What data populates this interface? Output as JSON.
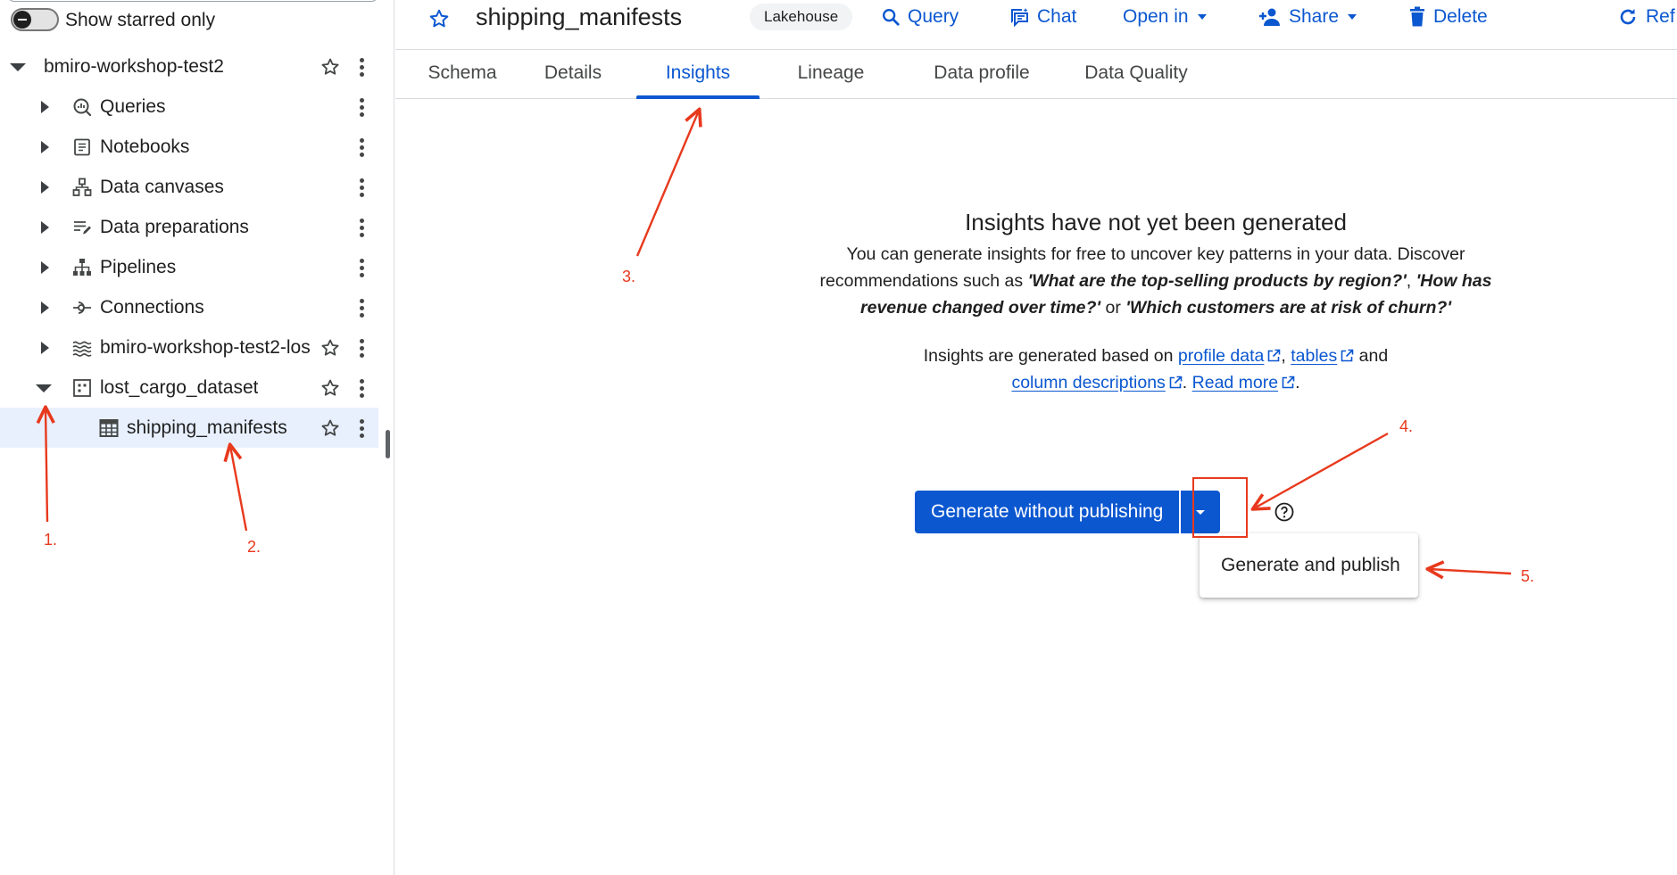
{
  "explorer": {
    "starred_toggle_label": "Show starred only",
    "project": {
      "label": "bmiro-workshop-test2"
    },
    "items": [
      {
        "label": "Queries",
        "icon": "queries-icon"
      },
      {
        "label": "Notebooks",
        "icon": "notebook-icon"
      },
      {
        "label": "Data canvases",
        "icon": "data-canvas-icon"
      },
      {
        "label": "Data preparations",
        "icon": "data-preparation-icon"
      },
      {
        "label": "Pipelines",
        "icon": "pipeline-icon"
      },
      {
        "label": "Connections",
        "icon": "connection-icon"
      },
      {
        "label": "bmiro-workshop-test2-los",
        "icon": "lake-icon"
      },
      {
        "label": "lost_cargo_dataset",
        "icon": "dataset-icon"
      },
      {
        "label": "shipping_manifests",
        "icon": "table-icon",
        "selected": true
      }
    ]
  },
  "header": {
    "title": "shipping_manifests",
    "chip": "Lakehouse",
    "actions": {
      "query": "Query",
      "chat": "Chat",
      "open_in": "Open in",
      "share": "Share",
      "delete": "Delete",
      "refresh": "Ref"
    }
  },
  "tabs": [
    {
      "label": "Schema"
    },
    {
      "label": "Details"
    },
    {
      "label": "Insights",
      "active": true
    },
    {
      "label": "Lineage"
    },
    {
      "label": "Data profile"
    },
    {
      "label": "Data Quality"
    }
  ],
  "empty_state": {
    "title": "Insights have not yet been generated",
    "desc_lead": "You can generate insights for free to uncover key patterns in your data. Discover recommendations such as ",
    "example_1": "'What are the top-selling products by region?'",
    "sep_1": ", ",
    "example_2": "'How has revenue changed over time?'",
    "or_text": " or ",
    "example_3": "'Which customers are at risk of churn?'",
    "basis_lead": "Insights are generated based on ",
    "link_profile": "profile data",
    "comma": ", ",
    "link_tables": "tables",
    "and_text": " and ",
    "link_columns": "column descriptions",
    "period_space": ". ",
    "link_read_more": "Read more",
    "final_period": "."
  },
  "generate": {
    "primary_label": "Generate without publishing",
    "menu_item": "Generate and publish"
  },
  "annotations": {
    "color": "#e8391d",
    "steps": [
      "1.",
      "2.",
      "3.",
      "4.",
      "5."
    ]
  },
  "colors": {
    "accent": "#0b57d0",
    "selected_row": "#e8f0fe",
    "annotation": "#e8391d"
  }
}
